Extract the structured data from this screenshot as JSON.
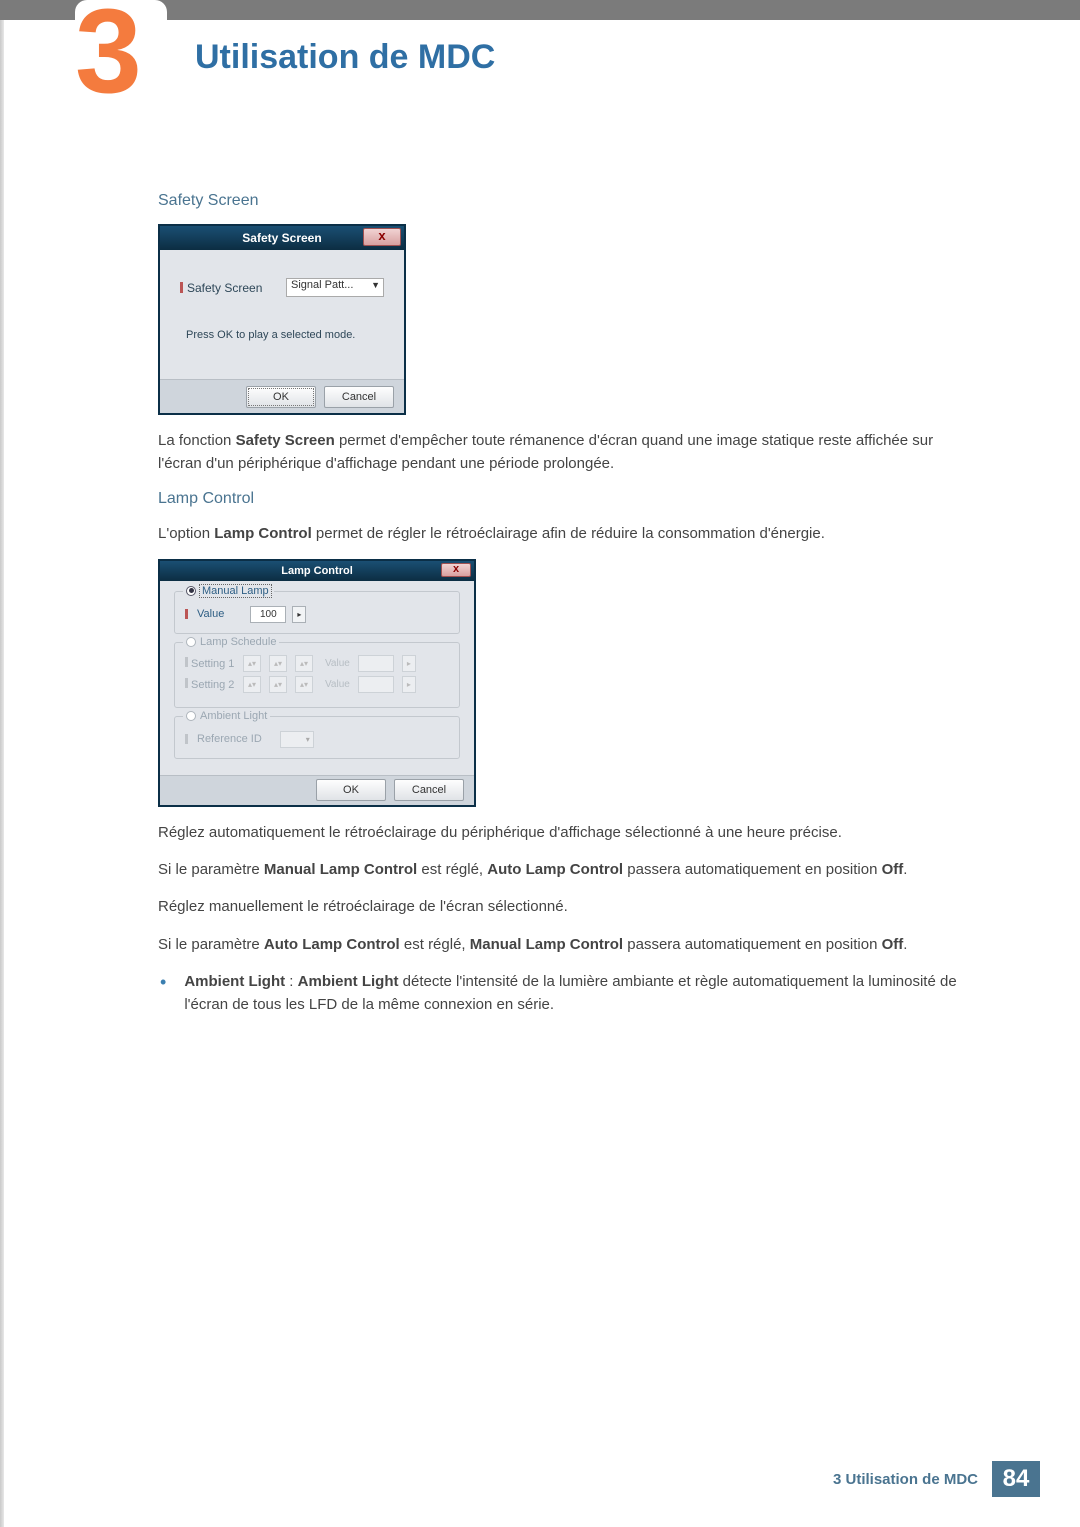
{
  "chapter": {
    "number": "3",
    "title": "Utilisation de MDC"
  },
  "safety": {
    "heading": "Safety Screen",
    "dialog": {
      "title": "Safety Screen",
      "close": "x",
      "label": "Safety Screen",
      "selectValue": "Signal Patt...",
      "note": "Press OK to play a selected mode.",
      "ok": "OK",
      "cancel": "Cancel"
    },
    "para_before": "La fonction ",
    "para_bold": "Safety Screen",
    "para_after": " permet d'empêcher toute rémanence d'écran quand une image statique reste affichée sur l'écran d'un périphérique d'affichage pendant une période prolongée."
  },
  "lamp": {
    "heading": "Lamp Control",
    "intro_before": "L'option ",
    "intro_bold": "Lamp Control",
    "intro_after": " permet de régler le rétroéclairage afin de réduire la consommation d'énergie.",
    "dialog": {
      "title": "Lamp Control",
      "close": "x",
      "manualLegend": "Manual Lamp",
      "valueLabel": "Value",
      "valueNum": "100",
      "schedLegend": "Lamp Schedule",
      "setting1": "Setting 1",
      "setting2": "Setting 2",
      "valueWord": "Value",
      "ambientLegend": "Ambient Light",
      "refId": "Reference ID",
      "ok": "OK",
      "cancel": "Cancel"
    },
    "p1": "Réglez automatiquement le rétroéclairage du périphérique d'affichage sélectionné à une heure précise.",
    "p2_a": "Si le paramètre ",
    "p2_b": "Manual Lamp Control",
    "p2_c": " est réglé, ",
    "p2_d": "Auto Lamp Control",
    "p2_e": " passera automatiquement en position ",
    "p2_f": "Off",
    "p2_g": ".",
    "p3": "Réglez manuellement le rétroéclairage de l'écran sélectionné.",
    "p4_a": "Si le paramètre ",
    "p4_b": "Auto Lamp Control",
    "p4_c": " est réglé, ",
    "p4_d": "Manual Lamp Control",
    "p4_e": " passera automatiquement en position ",
    "p4_f": "Off",
    "p4_g": ".",
    "bullet_a": "Ambient Light",
    "bullet_b": " : ",
    "bullet_c": "Ambient Light",
    "bullet_d": " détecte l'intensité de la lumière ambiante et règle automatiquement la luminosité de l'écran de tous les LFD de la même connexion en série."
  },
  "footer": {
    "text": "3 Utilisation de MDC",
    "page": "84"
  }
}
